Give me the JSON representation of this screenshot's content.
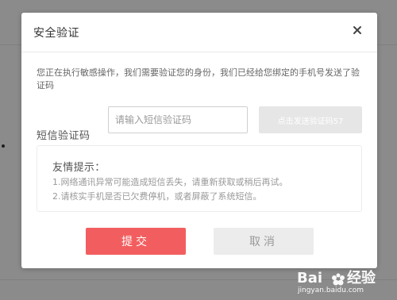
{
  "dialog": {
    "title": "安全验证",
    "description": "您正在执行敏感操作，我们需要验证您的身份，我们已经给您绑定的手机号发送了验证码",
    "sms_label": "短信验证码",
    "sms_input": {
      "value": "",
      "placeholder": "请输入短信验证码"
    },
    "send_code_button": "点击发送验证码57",
    "tips": {
      "title": "友情提示：",
      "lines": [
        "1.网络通讯异常可能造成短信丢失，请重新获取或稍后再试。",
        "2.请核实手机是否已欠费停机，或者屏蔽了系统短信。"
      ]
    },
    "submit_button": "提交",
    "cancel_button": "取消"
  },
  "watermark": {
    "brand": "Baidu",
    "product": "经验",
    "url": "jingyan.baidu.com"
  },
  "icons": {
    "close": "close-icon",
    "watermark": "baidu-paw-icon"
  },
  "colors": {
    "overlay": "#8f8f8f",
    "submit": "#f25e5f",
    "send_code_disabled": "#e6e6e6",
    "cancel": "#ececec"
  }
}
